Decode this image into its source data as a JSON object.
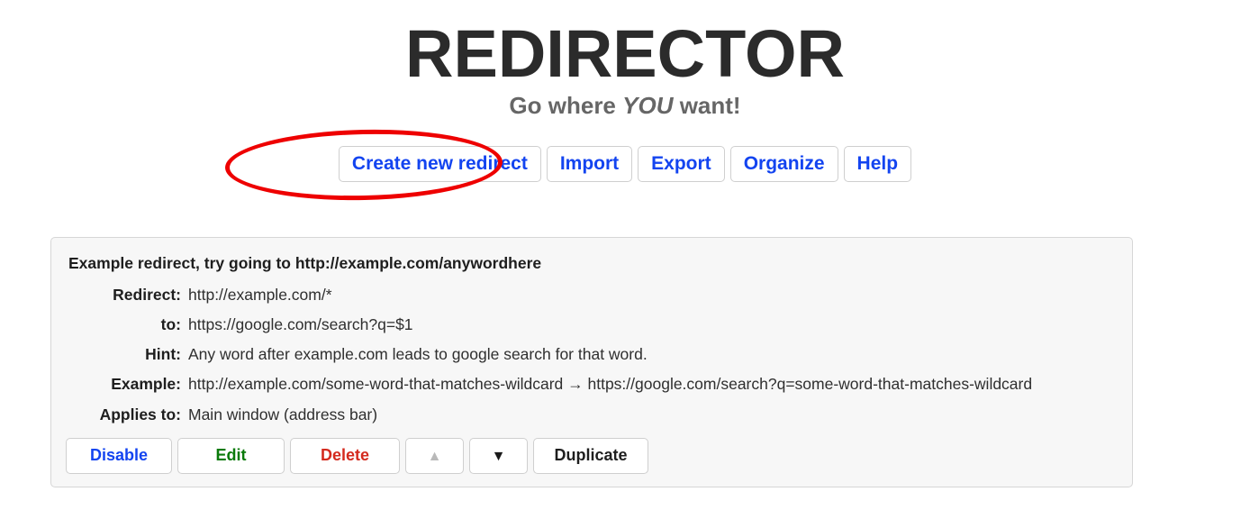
{
  "header": {
    "title": "REDIRECTOR",
    "subtitle_before": "Go where ",
    "subtitle_emph": "YOU",
    "subtitle_after": " want!"
  },
  "toolbar": {
    "buttons": [
      {
        "label": "Create new redirect",
        "name": "create-new-redirect-button"
      },
      {
        "label": "Import",
        "name": "import-button"
      },
      {
        "label": "Export",
        "name": "export-button"
      },
      {
        "label": "Organize",
        "name": "organize-button"
      },
      {
        "label": "Help",
        "name": "help-button"
      }
    ],
    "annotation": {
      "shape": "ellipse",
      "color": "#ee0000",
      "targets": "Create new redirect"
    }
  },
  "redirect_card": {
    "description": "Example redirect, try going to http://example.com/anywordhere",
    "fields": [
      {
        "label": "Redirect:",
        "value": "http://example.com/*"
      },
      {
        "label": "to:",
        "value": "https://google.com/search?q=$1"
      },
      {
        "label": "Hint:",
        "value": "Any word after example.com leads to google search for that word."
      },
      {
        "label": "Example:",
        "value": "http://example.com/some-word-that-matches-wildcard → https://google.com/search?q=some-word-that-matches-wildcard"
      },
      {
        "label": "Applies to:",
        "value": "Main window (address bar)"
      }
    ],
    "actions": [
      {
        "label": "Disable",
        "color": "#1344f0"
      },
      {
        "label": "Edit",
        "color": "#0a7a0a"
      },
      {
        "label": "Delete",
        "color": "#d42a1e"
      },
      {
        "label": "▲",
        "color": "#b9b9b9"
      },
      {
        "label": "▼",
        "color": "#1a1a1a"
      },
      {
        "label": "Duplicate",
        "color": "#1e1e1e"
      }
    ]
  },
  "colors": {
    "page_background": "#ffffff",
    "panel_background": "#f7f7f7",
    "panel_border": "#d6d6d6",
    "button_border": "#cfcfcf",
    "link_blue": "#1344f0",
    "title_gray": "#2b2b2b",
    "subtitle_gray": "#666666",
    "annotation_red": "#ee0000"
  }
}
